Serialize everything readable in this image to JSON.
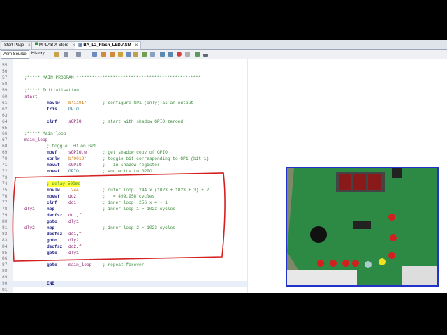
{
  "tabs": [
    {
      "label": "Start Page",
      "close": "x"
    },
    {
      "label": "MPLAB X Store",
      "close": "x"
    },
    {
      "label": "BA_L2_Flash_LED.ASM",
      "close": "x"
    }
  ],
  "toolbar": {
    "asm_source": "Asm Source",
    "history": "History"
  },
  "code": [
    {
      "n": "55"
    },
    {
      "n": "56"
    },
    {
      "n": "57",
      "full": ";***** MAIN PROGRAM ************************************************"
    },
    {
      "n": "58"
    },
    {
      "n": "59",
      "full": ";***** Initialisation"
    },
    {
      "n": "60",
      "label": "start"
    },
    {
      "n": "61",
      "ins": "movlw",
      "op": "b'1101'",
      "opt": "str",
      "cm": "; configure GP1 (only) as an output"
    },
    {
      "n": "62",
      "ins": "tris",
      "op": "GPIO",
      "opt": "reg"
    },
    {
      "n": "63"
    },
    {
      "n": "64",
      "ins": "clrf",
      "op": "sGPIO",
      "cm": "; start with shadow GPIO zeroed"
    },
    {
      "n": "65"
    },
    {
      "n": "66",
      "full": ";***** Main loop"
    },
    {
      "n": "67",
      "label": "main_loop"
    },
    {
      "n": "68",
      "mid": "; toggle LED on GP1"
    },
    {
      "n": "69",
      "ins": "movf",
      "op": "sGPIO,w",
      "cm": "; get shadow copy of GPIO"
    },
    {
      "n": "70",
      "ins": "xorlw",
      "op": "b'0010'",
      "opt": "str",
      "cm": "; toggle bit corresponding to GP1 (bit 1)"
    },
    {
      "n": "71",
      "ins": "movwf",
      "op": "sGPIO",
      "cm": ";   in shadow register"
    },
    {
      "n": "72",
      "ins": "movwf",
      "op": "GPIO",
      "opt": "reg",
      "cm": "; and write to GPIO"
    },
    {
      "n": "73"
    },
    {
      "n": "74",
      "mid": "; delay 500ms",
      "highlight": true
    },
    {
      "n": "75",
      "ins": "movlw",
      "op": ".244",
      "opt": "str",
      "cm": "; outer loop: 244 x (1023 + 1023 + 3) + 2"
    },
    {
      "n": "76",
      "ins": "movwf",
      "op": "dc2",
      "cm": ";   = 499,958 cycles"
    },
    {
      "n": "77",
      "ins": "clrf",
      "op": "dc1",
      "cm": "; inner loop: 256 x 4 - 1"
    },
    {
      "n": "78",
      "label": "dly1",
      "ins": "nop",
      "cm": "; inner loop 1 = 1023 cycles"
    },
    {
      "n": "79",
      "ins": "decfsz",
      "op": "dc1,f"
    },
    {
      "n": "80",
      "ins": "goto",
      "op": "dly1"
    },
    {
      "n": "81",
      "label": "dly2",
      "ins": "nop",
      "cm": "; inner loop 2 = 1023 cycles"
    },
    {
      "n": "82",
      "ins": "decfsz",
      "op": "dc1,f"
    },
    {
      "n": "83",
      "ins": "goto",
      "op": "dly2"
    },
    {
      "n": "84",
      "ins": "decfsz",
      "op": "dc2,f"
    },
    {
      "n": "85",
      "ins": "goto",
      "op": "dly1"
    },
    {
      "n": "86"
    },
    {
      "n": "87",
      "ins": "goto",
      "op": "main_loop",
      "cm": "; repeat forever"
    },
    {
      "n": "88"
    },
    {
      "n": "89"
    },
    {
      "n": "90",
      "ins": "END",
      "current": true
    },
    {
      "n": "91"
    }
  ],
  "colors": {
    "annotation": "#d42020",
    "photo_border": "#2233cc",
    "highlight": "#ffff3a"
  }
}
